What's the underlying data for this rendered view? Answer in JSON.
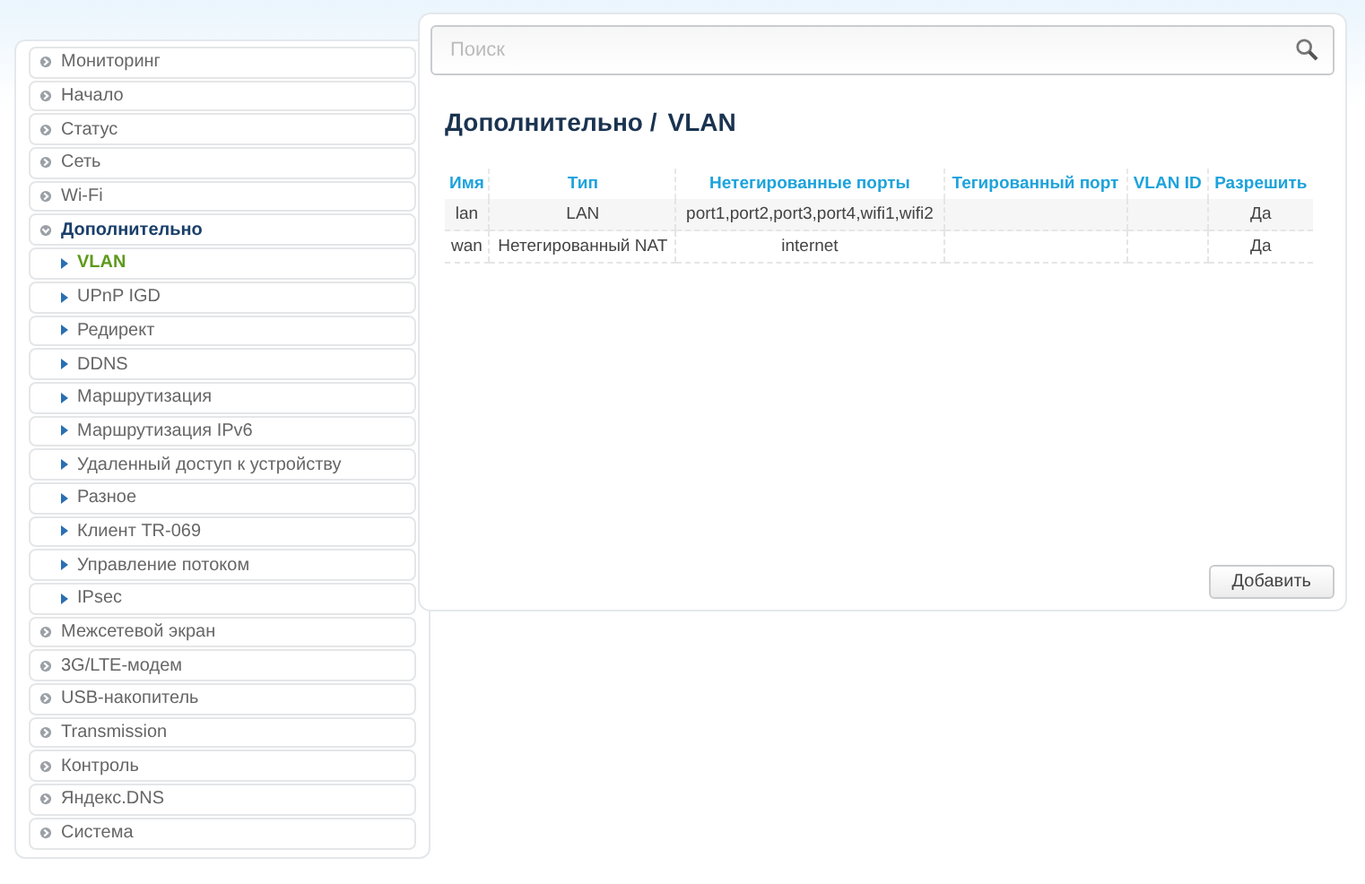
{
  "menu": [
    {
      "label": "Мониторинг",
      "expanded": false
    },
    {
      "label": "Начало",
      "expanded": false
    },
    {
      "label": "Статус",
      "expanded": false
    },
    {
      "label": "Сеть",
      "expanded": false
    },
    {
      "label": "Wi-Fi",
      "expanded": false
    },
    {
      "label": "Дополнительно",
      "expanded": true,
      "children": [
        {
          "label": "VLAN",
          "selected": true
        },
        {
          "label": "UPnP IGD",
          "selected": false
        },
        {
          "label": "Редирект",
          "selected": false
        },
        {
          "label": "DDNS",
          "selected": false
        },
        {
          "label": "Маршрутизация",
          "selected": false
        },
        {
          "label": "Маршрутизация IPv6",
          "selected": false
        },
        {
          "label": "Удаленный доступ к устройству",
          "selected": false
        },
        {
          "label": "Разное",
          "selected": false
        },
        {
          "label": "Клиент TR-069",
          "selected": false
        },
        {
          "label": "Управление потоком",
          "selected": false
        },
        {
          "label": "IPsec",
          "selected": false
        }
      ]
    },
    {
      "label": "Межсетевой экран",
      "expanded": false
    },
    {
      "label": "3G/LTE-модем",
      "expanded": false
    },
    {
      "label": "USB-накопитель",
      "expanded": false
    },
    {
      "label": "Transmission",
      "expanded": false
    },
    {
      "label": "Контроль",
      "expanded": false
    },
    {
      "label": "Яндекс.DNS",
      "expanded": false
    },
    {
      "label": "Система",
      "expanded": false
    }
  ],
  "search": {
    "placeholder": "Поиск"
  },
  "breadcrumb": [
    "Дополнительно /",
    "VLAN"
  ],
  "table": {
    "columns": [
      "Имя",
      "Тип",
      "Нетегированные порты",
      "Тегированный порт",
      "VLAN ID",
      "Разрешить"
    ],
    "rows": [
      [
        "lan",
        "LAN",
        "port1,port2,port3,port4,wifi1,wifi2",
        "",
        "",
        "Да"
      ],
      [
        "wan",
        "Нетегированный NAT",
        "internet",
        "",
        "",
        "Да"
      ]
    ]
  },
  "buttons": [
    "Добавить"
  ]
}
